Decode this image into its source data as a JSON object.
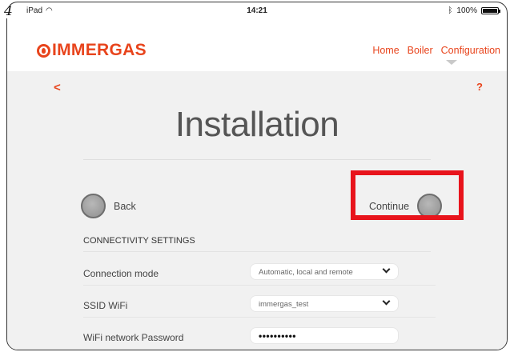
{
  "step_number": "4",
  "status_bar": {
    "device": "iPad",
    "time": "14:21",
    "battery": "100%"
  },
  "header": {
    "logo": "IMMERGAS",
    "nav": [
      "Home",
      "Boiler",
      "Configuration"
    ]
  },
  "toolbar": {
    "back_icon": "<",
    "help_icon": "?"
  },
  "page": {
    "title": "Installation"
  },
  "buttons": {
    "back_label": "Back",
    "continue_label": "Continue"
  },
  "connectivity": {
    "section_title": "CONNECTIVITY SETTINGS",
    "connection_mode": {
      "label": "Connection mode",
      "value": "Automatic, local and remote"
    },
    "ssid": {
      "label": "SSID WiFi",
      "value": "immergas_test"
    },
    "password": {
      "label": "WiFi network Password",
      "value": "••••••••••"
    }
  },
  "colors": {
    "accent": "#e8441c",
    "highlight": "#e8141c",
    "content_bg": "#f1f1f1"
  },
  "icons": [
    "wifi-icon",
    "bluetooth-icon",
    "battery-icon",
    "chevron-left-icon",
    "help-icon",
    "chevron-down-icon"
  ]
}
